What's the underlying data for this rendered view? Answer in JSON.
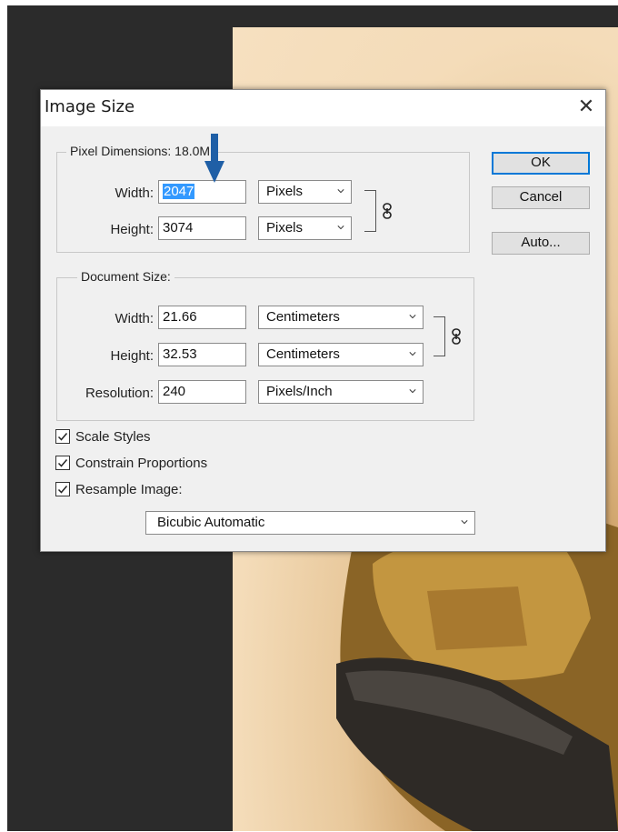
{
  "dialog": {
    "title": "Image Size",
    "close_glyph": "✕"
  },
  "pixel_dimensions": {
    "legend": "Pixel Dimensions:",
    "size": "18.0M",
    "width_label": "Width:",
    "width_value": "2047",
    "width_unit": "Pixels",
    "height_label": "Height:",
    "height_value": "3074",
    "height_unit": "Pixels"
  },
  "document_size": {
    "legend": "Document Size:",
    "width_label": "Width:",
    "width_value": "21.66",
    "width_unit": "Centimeters",
    "height_label": "Height:",
    "height_value": "32.53",
    "height_unit": "Centimeters",
    "resolution_label": "Resolution:",
    "resolution_value": "240",
    "resolution_unit": "Pixels/Inch"
  },
  "options": {
    "scale_styles": {
      "label": "Scale Styles",
      "checked": true
    },
    "constrain_proportions": {
      "label": "Constrain Proportions",
      "checked": true
    },
    "resample_image": {
      "label": "Resample Image:",
      "checked": true
    },
    "resample_method": "Bicubic Automatic"
  },
  "buttons": {
    "ok": "OK",
    "cancel": "Cancel",
    "auto": "Auto..."
  },
  "icons": {
    "link": "link-icon",
    "chevron": "chevron-down-icon",
    "check": "check-icon",
    "annotation_arrow": "down-arrow-icon"
  },
  "colors": {
    "selection": "#3399ff",
    "annotation_arrow": "#1f5fa6",
    "default_button_border": "#0078d7",
    "app_background": "#2b2b2b"
  }
}
